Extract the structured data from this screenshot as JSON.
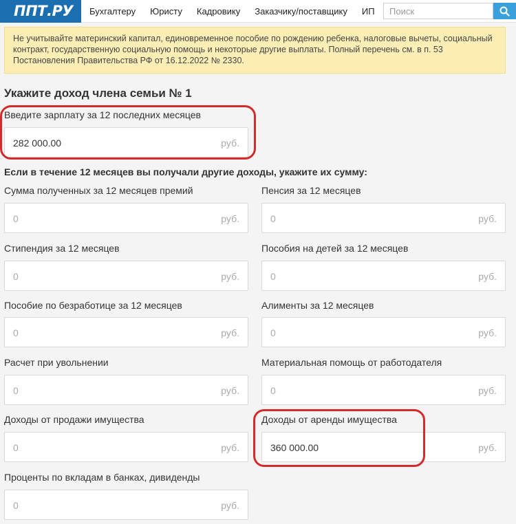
{
  "header": {
    "logo": "ППТ.РУ",
    "nav": [
      "Бухгалтеру",
      "Юристу",
      "Кадровику",
      "Заказчику/поставщику",
      "ИП"
    ],
    "search_placeholder": "Поиск"
  },
  "notice": "Не учитывайте материнский капитал, единовременное пособие по рождению ребенка, налоговые вычеты, социальный контракт, государственную социальную помощь и некоторые другие выплаты. Полный перечень см. в п. 53 Постановления Правительства РФ от 16.12.2022 № 2330.",
  "section_title": "Укажите доход члена семьи № 1",
  "salary": {
    "label": "Введите зарплату за 12 последних месяцев",
    "value": "282 000.00",
    "unit": "руб."
  },
  "other_income_title": "Если в течение 12 месяцев вы получали другие доходы, укажите их сумму:",
  "fields": [
    {
      "label": "Сумма полученных за 12 месяцев премий",
      "value": "0",
      "unit": "руб."
    },
    {
      "label": "Пенсия за 12 месяцев",
      "value": "0",
      "unit": "руб."
    },
    {
      "label": "Стипендия за 12 месяцев",
      "value": "0",
      "unit": "руб."
    },
    {
      "label": "Пособия на детей за 12 месяцев",
      "value": "0",
      "unit": "руб."
    },
    {
      "label": "Пособие по безработице за 12 месяцев",
      "value": "0",
      "unit": "руб."
    },
    {
      "label": "Алименты за 12 месяцев",
      "value": "0",
      "unit": "руб."
    },
    {
      "label": "Расчет при увольнении",
      "value": "0",
      "unit": "руб."
    },
    {
      "label": "Материальная помощь от работодателя",
      "value": "0",
      "unit": "руб."
    },
    {
      "label": "Доходы от продажи имущества",
      "value": "0",
      "unit": "руб."
    },
    {
      "label": "Доходы от аренды имущества",
      "value": "360 000.00",
      "unit": "руб."
    },
    {
      "label": "Проценты по вкладам в банках, дивиденды",
      "value": "0",
      "unit": "руб."
    }
  ],
  "colors": {
    "logo_bg": "#1b6fb0",
    "search_button": "#3aa0db",
    "notice_bg": "#fdeeb6",
    "highlight": "#d42a2a"
  },
  "icons": {
    "search_button": "magnifier-icon"
  }
}
